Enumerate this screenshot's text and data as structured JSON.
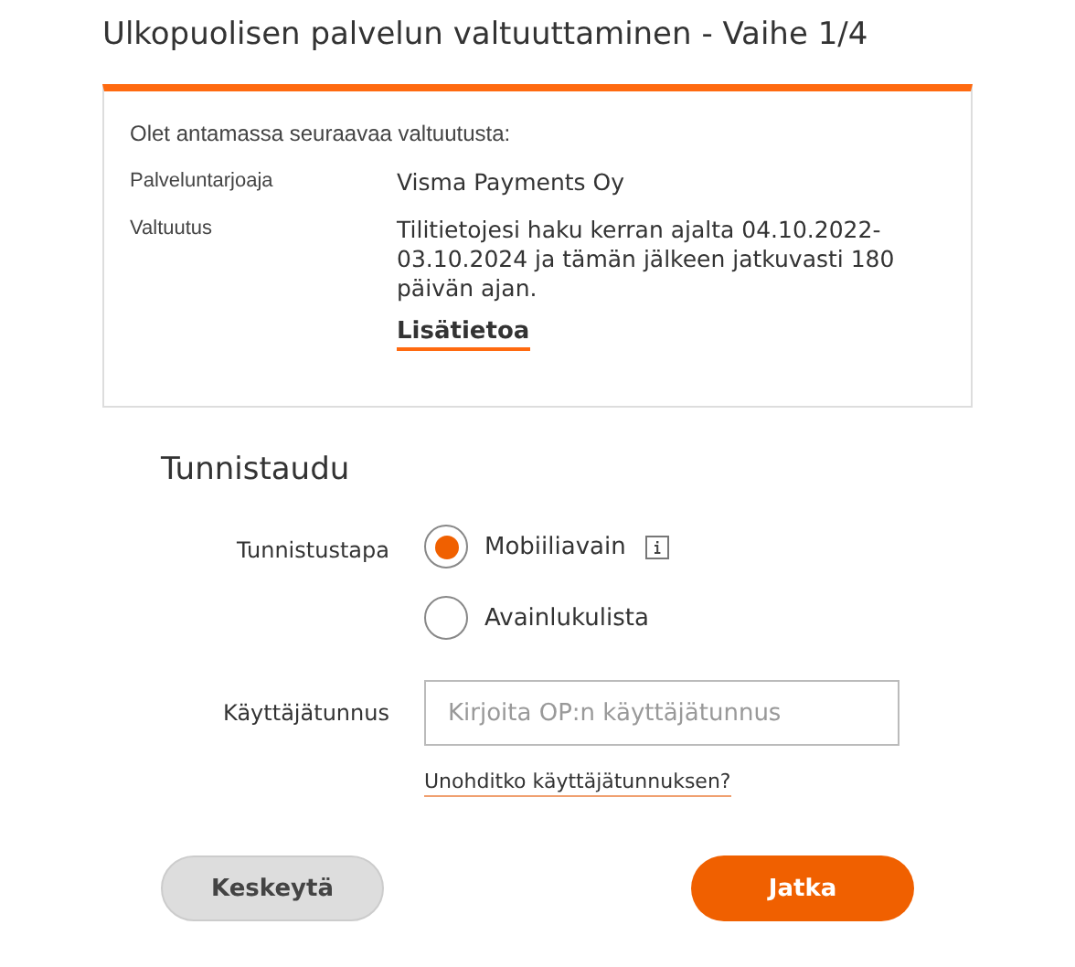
{
  "title": "Ulkopuolisen palvelun valtuuttaminen - Vaihe 1/4",
  "summary": {
    "intro": "Olet antamassa seuraavaa valtuutusta:",
    "rows": [
      {
        "label": "Palveluntarjoaja",
        "value": "Visma Payments Oy"
      },
      {
        "label": "Valtuutus",
        "value": "Tilitietojesi haku kerran ajalta 04.10.2022-03.10.2024 ja tämän jälkeen jatkuvasti 180 päivän ajan."
      }
    ],
    "link": "Lisätietoa"
  },
  "auth": {
    "heading": "Tunnistaudu",
    "method_label": "Tunnistustapa",
    "options": [
      {
        "label": "Mobiiliavain",
        "selected": true,
        "info": true
      },
      {
        "label": "Avainlukulista",
        "selected": false,
        "info": false
      }
    ],
    "username_label": "Käyttäjätunnus",
    "username_placeholder": "Kirjoita OP:n käyttäjätunnus",
    "forgot_link": "Unohditko käyttäjätunnuksen?"
  },
  "buttons": [
    {
      "label": "Keskeytä",
      "kind": "secondary"
    },
    {
      "label": "Jatka",
      "kind": "primary"
    }
  ]
}
